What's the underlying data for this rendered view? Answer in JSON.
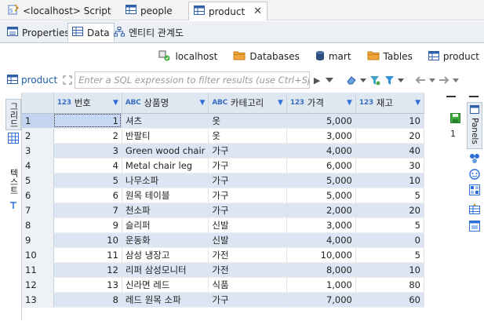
{
  "editor_tabs": [
    {
      "label": "<localhost> Script",
      "active": false
    },
    {
      "label": "people",
      "active": false
    },
    {
      "label": "product",
      "active": true
    }
  ],
  "sub_tabs": [
    {
      "label": "Properties",
      "active": false
    },
    {
      "label": "Data",
      "active": true
    },
    {
      "label": "엔티티 관계도",
      "active": false
    }
  ],
  "breadcrumb": [
    "localhost",
    "Databases",
    "mart",
    "Tables",
    "product"
  ],
  "filter": {
    "table_label": "product",
    "placeholder": "Enter a SQL expression to filter results (use Ctrl+Spac"
  },
  "left_tabs": {
    "grid": "그리드",
    "text": "텍스트"
  },
  "right_panel_label": "Panels",
  "columns": [
    {
      "type": "123",
      "label": "번호"
    },
    {
      "type": "ABC",
      "label": "상품명"
    },
    {
      "type": "ABC",
      "label": "카테고리"
    },
    {
      "type": "123",
      "label": "가격"
    },
    {
      "type": "123",
      "label": "재고"
    }
  ],
  "rows": [
    {
      "n": "1",
      "id": "1",
      "name": "셔츠",
      "cat": "옷",
      "price": "5,000",
      "stock": "10"
    },
    {
      "n": "2",
      "id": "2",
      "name": "반팔티",
      "cat": "옷",
      "price": "3,000",
      "stock": "20"
    },
    {
      "n": "3",
      "id": "3",
      "name": "Green wood chair",
      "cat": "가구",
      "price": "4,000",
      "stock": "40"
    },
    {
      "n": "4",
      "id": "4",
      "name": "Metal chair leg",
      "cat": "가구",
      "price": "6,000",
      "stock": "30"
    },
    {
      "n": "5",
      "id": "5",
      "name": "나무소파",
      "cat": "가구",
      "price": "5,000",
      "stock": "10"
    },
    {
      "n": "6",
      "id": "6",
      "name": "원목 테이블",
      "cat": "가구",
      "price": "5,000",
      "stock": "5"
    },
    {
      "n": "7",
      "id": "7",
      "name": "천소파",
      "cat": "가구",
      "price": "2,000",
      "stock": "20"
    },
    {
      "n": "8",
      "id": "9",
      "name": "슬리퍼",
      "cat": "신발",
      "price": "3,000",
      "stock": "5"
    },
    {
      "n": "9",
      "id": "10",
      "name": "운동화",
      "cat": "신발",
      "price": "4,000",
      "stock": "0"
    },
    {
      "n": "10",
      "id": "11",
      "name": "삼성 냉장고",
      "cat": "가전",
      "price": "10,000",
      "stock": "5"
    },
    {
      "n": "11",
      "id": "12",
      "name": "리퍼 삼성모니터",
      "cat": "가전",
      "price": "8,000",
      "stock": "10"
    },
    {
      "n": "12",
      "id": "13",
      "name": "신라면 레드",
      "cat": "식품",
      "price": "1,000",
      "stock": "80"
    },
    {
      "n": "13",
      "id": "8",
      "name": "레드 원목 소파",
      "cat": "가구",
      "price": "7,000",
      "stock": "60"
    }
  ],
  "side_counter": "1",
  "colors": {
    "accent": "#1d5fa8",
    "header_bg": "#dfe7f1",
    "alt_row": "#dbe5f3"
  }
}
